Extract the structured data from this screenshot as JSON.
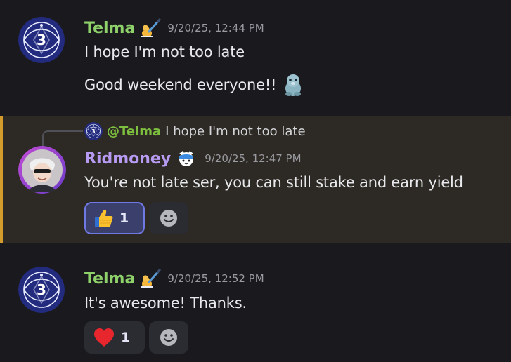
{
  "messages": [
    {
      "author": "Telma",
      "author_color": "#8ed16a",
      "timestamp": "9/20/25, 12:44 PM",
      "avatar_icon": "third-eye-chakra-icon",
      "author_badge_icon": "writing-hand-icon",
      "lines": [
        "I hope I'm not too late",
        "Good weekend everyone!!"
      ],
      "inline_emoji_icon": "seal-emoji-icon"
    },
    {
      "author": "Ridmoney",
      "author_color": "#b79bf2",
      "timestamp": "9/20/25, 12:47 PM",
      "avatar_icon": "anime-character-avatar",
      "author_badge_icon": "cat-badge-icon",
      "highlight_color": "#d39b2b",
      "reply": {
        "mention": "@Telma",
        "text": "I hope I'm not too late"
      },
      "lines": [
        "You're not late ser, you can still stake and earn yield"
      ],
      "reactions": [
        {
          "emoji_icon": "thumbs-up-icon",
          "count": "1",
          "active": true
        }
      ]
    },
    {
      "author": "Telma",
      "author_color": "#8ed16a",
      "timestamp": "9/20/25, 12:52 PM",
      "avatar_icon": "third-eye-chakra-icon",
      "author_badge_icon": "writing-hand-icon",
      "lines": [
        "It's awesome! Thanks."
      ],
      "reactions": [
        {
          "emoji_icon": "red-heart-icon",
          "count": "1",
          "active": false
        }
      ]
    }
  ],
  "add_reaction_icon": "smiley-add-reaction-icon"
}
